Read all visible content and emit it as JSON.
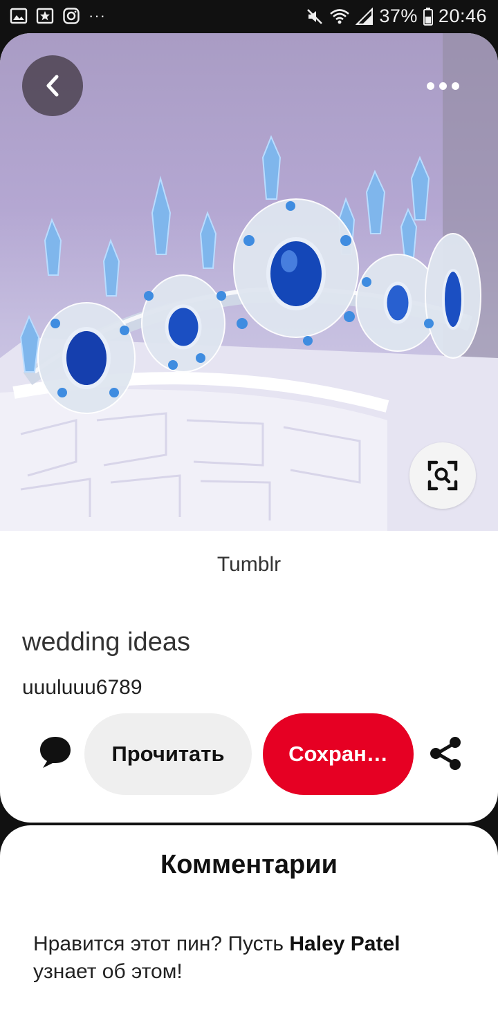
{
  "status_bar": {
    "left_icons": [
      "gallery-icon",
      "star-app-icon",
      "instagram-icon",
      "more-notifications-icon"
    ],
    "more_text": "···",
    "battery_text": "37%",
    "time": "20:46"
  },
  "pin": {
    "source": "Tumblr",
    "title": "wedding ideas",
    "author": "uuuluuu6789",
    "buttons": {
      "read_label": "Прочитать",
      "save_label": "Сохран…"
    }
  },
  "comments": {
    "title": "Комментарии",
    "prompt_before": "Нравится этот пин? Пусть ",
    "prompt_name": "Haley Patel",
    "prompt_after": " узнает об этом!"
  },
  "colors": {
    "save_button": "#e60023",
    "read_button": "#efefef",
    "background": "#111111"
  }
}
